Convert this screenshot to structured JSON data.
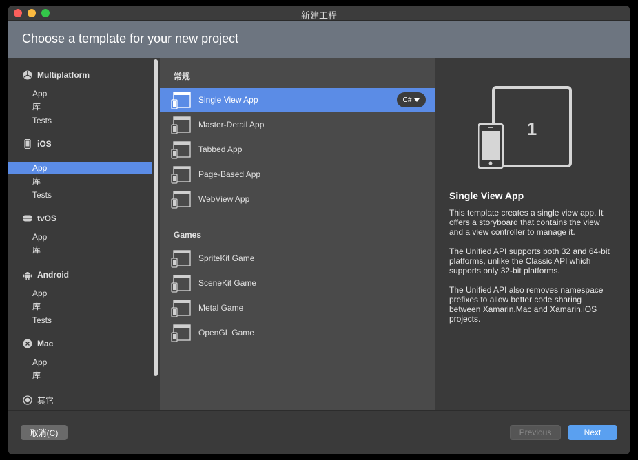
{
  "window": {
    "title": "新建工程",
    "header_title": "Choose a template for your new project"
  },
  "sidebar": {
    "categories": [
      {
        "label": "Multiplatform",
        "icon": "multiplatform-icon",
        "items": [
          "App",
          "库",
          "Tests"
        ]
      },
      {
        "label": "iOS",
        "icon": "iphone-icon",
        "items": [
          "App",
          "库",
          "Tests"
        ]
      },
      {
        "label": "tvOS",
        "icon": "appletv-icon",
        "items": [
          "App",
          "库"
        ]
      },
      {
        "label": "Android",
        "icon": "android-icon",
        "items": [
          "App",
          "库",
          "Tests"
        ]
      },
      {
        "label": "Mac",
        "icon": "mac-x-icon",
        "items": [
          "App",
          "库"
        ]
      },
      {
        "label": "其它",
        "icon": "other-circle-icon",
        "items": []
      }
    ],
    "selected": "iOS / App"
  },
  "templates": {
    "section_general": "常规",
    "general": [
      {
        "label": "Single View App",
        "selected": true,
        "language": "C#"
      },
      {
        "label": "Master-Detail App"
      },
      {
        "label": "Tabbed App"
      },
      {
        "label": "Page-Based App"
      },
      {
        "label": "WebView App"
      }
    ],
    "section_games": "Games",
    "games": [
      {
        "label": "SpriteKit Game"
      },
      {
        "label": "SceneKit Game"
      },
      {
        "label": "Metal Game"
      },
      {
        "label": "OpenGL Game"
      }
    ]
  },
  "preview": {
    "title": "Single View App",
    "art_number": "1",
    "paragraphs": [
      "This template creates a single view app. It offers a storyboard that contains the view and a view controller to manage it.",
      "The Unified API supports both 32 and 64-bit platforms, unlike the Classic API which supports only 32-bit platforms.",
      "The Unified API also removes namespace prefixes to allow better code sharing between Xamarin.Mac and Xamarin.iOS projects."
    ]
  },
  "footer": {
    "cancel_label": "取消(C)",
    "previous_label": "Previous",
    "next_label": "Next"
  },
  "colors": {
    "selection": "#5b8ce6",
    "header": "#6d7580",
    "next_button": "#5aa0f0"
  }
}
